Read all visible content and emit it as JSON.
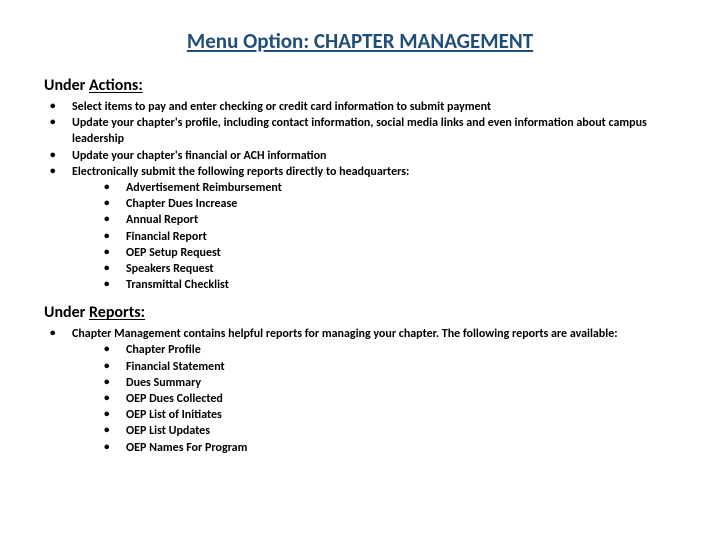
{
  "title": "Menu Option: CHAPTER MANAGEMENT",
  "sections": {
    "actions": {
      "heading_prefix": "Under ",
      "heading_label": "Actions:",
      "items": {
        "i0": "Select items to pay and enter checking or credit card information to submit payment",
        "i1": "Update your chapter's profile, including contact information, social media links and even information about campus leadership",
        "i2": "Update your chapter's financial or ACH information",
        "i3": "Electronically submit the following reports directly to headquarters:",
        "i3_sub": {
          "s0": "Advertisement Reimbursement",
          "s1": "Chapter Dues Increase",
          "s2": "Annual Report",
          "s3": "Financial Report",
          "s4": "OEP Setup Request",
          "s5": "Speakers Request",
          "s6": "Transmittal Checklist"
        }
      }
    },
    "reports": {
      "heading_prefix": "Under ",
      "heading_label": "Reports:",
      "items": {
        "i0": "Chapter Management contains helpful reports for managing your chapter. The following reports are available:",
        "i0_sub": {
          "s0": "Chapter Profile",
          "s1": "Financial Statement",
          "s2": "Dues Summary",
          "s3": "OEP Dues Collected",
          "s4": "OEP List of Initiates",
          "s5": "OEP List Updates",
          "s6": "OEP Names For Program"
        }
      }
    }
  }
}
